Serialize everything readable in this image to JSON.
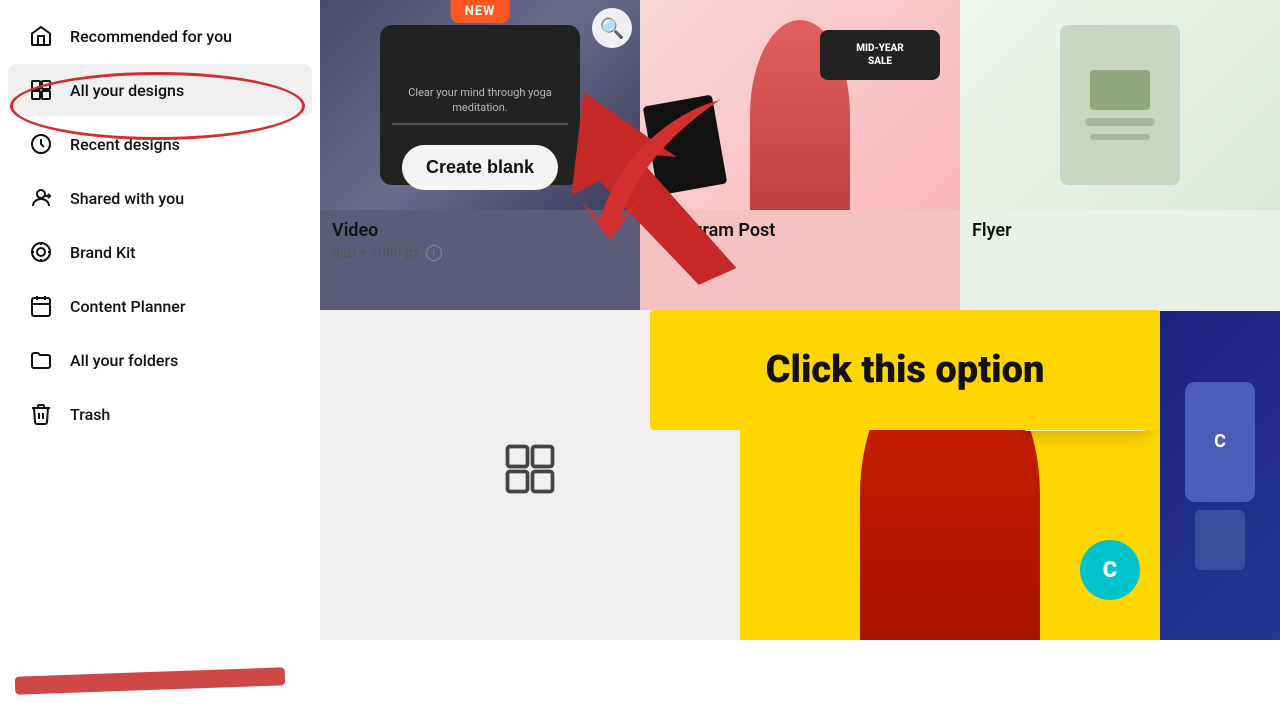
{
  "sidebar": {
    "items": [
      {
        "id": "recommended",
        "label": "Recommended for you",
        "icon": "home"
      },
      {
        "id": "all-designs",
        "label": "All your designs",
        "icon": "grid"
      },
      {
        "id": "recent",
        "label": "Recent designs",
        "icon": "clock"
      },
      {
        "id": "shared",
        "label": "Shared with you",
        "icon": "shared"
      },
      {
        "id": "brand-kit",
        "label": "Brand Kit",
        "icon": "brand"
      },
      {
        "id": "content-planner",
        "label": "Content Planner",
        "icon": "calendar"
      },
      {
        "id": "folders",
        "label": "All your folders",
        "icon": "folder"
      },
      {
        "id": "trash",
        "label": "Trash",
        "icon": "trash"
      }
    ]
  },
  "main": {
    "new_badge": "NEW",
    "create_blank": "Create blank",
    "cards": [
      {
        "id": "video",
        "title": "Video",
        "subtitle": "920 × 1080 px"
      },
      {
        "id": "instagram",
        "title": "Instagram Post",
        "subtitle": ""
      },
      {
        "id": "flyer",
        "title": "Flyer",
        "subtitle": ""
      }
    ],
    "annotation": {
      "banner_text": "Click this option"
    }
  }
}
